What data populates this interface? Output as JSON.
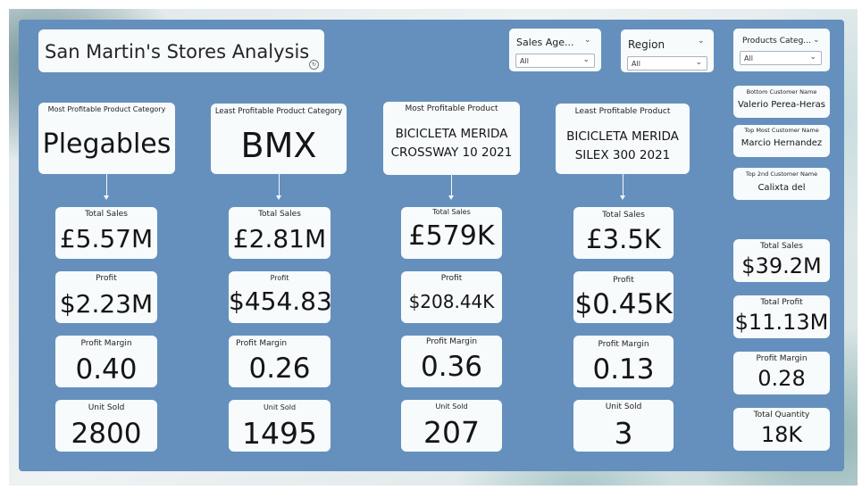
{
  "title": "San Martin's Stores Analysis",
  "info_icon": "refresh-info-icon",
  "slicers": [
    {
      "title": "Sales Age...",
      "value": "All"
    },
    {
      "title": "Region",
      "value": "All"
    },
    {
      "title": "Products Categ...",
      "value": "All"
    }
  ],
  "columns": [
    {
      "header_label": "Most Profitable Product Category",
      "header_value": "Plegables",
      "total_sales_label": "Total Sales",
      "total_sales": "£5.57M",
      "profit_label": "Profit",
      "profit": "$2.23M",
      "margin_label": "Profit Margin",
      "margin": "0.40",
      "units_label": "Unit Sold",
      "units": "2800"
    },
    {
      "header_label": "Least Profitable Product Category",
      "header_value": "BMX",
      "total_sales_label": "Total Sales",
      "total_sales": "£2.81M",
      "profit_label": "Profit",
      "profit": "$454.83",
      "margin_label": "Profit Margin",
      "margin": "0.26",
      "units_label": "Unit Sold",
      "units": "1495"
    },
    {
      "header_label": "Most Profitable Product",
      "header_value_line1": "BICICLETA MERIDA",
      "header_value_line2": "CROSSWAY 10 2021",
      "total_sales_label": "Total Sales",
      "total_sales": "£579K",
      "profit_label": "Profit",
      "profit": "$208.44K",
      "margin_label": "Profit Margin",
      "margin": "0.36",
      "units_label": "Unit Sold",
      "units": "207"
    },
    {
      "header_label": "Least Profitable Product",
      "header_value_line1": "BICICLETA MERIDA",
      "header_value_line2": "SILEX 300 2021",
      "total_sales_label": "Total Sales",
      "total_sales": "£3.5K",
      "profit_label": "Profit",
      "profit": "$0.45K",
      "margin_label": "Profit Margin",
      "margin": "0.13",
      "units_label": "Unit Sold",
      "units": "3"
    }
  ],
  "customers": [
    {
      "label": "Bottom Customer Name",
      "value": "Valerio Perea-Heras"
    },
    {
      "label": "Top Most Customer Name",
      "value": "Marcio Hernandez"
    },
    {
      "label": "Top 2nd Customer Name",
      "value": "Calixta del"
    }
  ],
  "totals": [
    {
      "label": "Total Sales",
      "value": "$39.2M"
    },
    {
      "label": "Total Profit",
      "value": "$11.13M"
    },
    {
      "label": "Profit Margin",
      "value": "0.28"
    },
    {
      "label": "Total Quantity",
      "value": "18K"
    }
  ],
  "colors": {
    "canvas": "#6590bd",
    "card": "#f7fbfc",
    "text": "#151515"
  }
}
